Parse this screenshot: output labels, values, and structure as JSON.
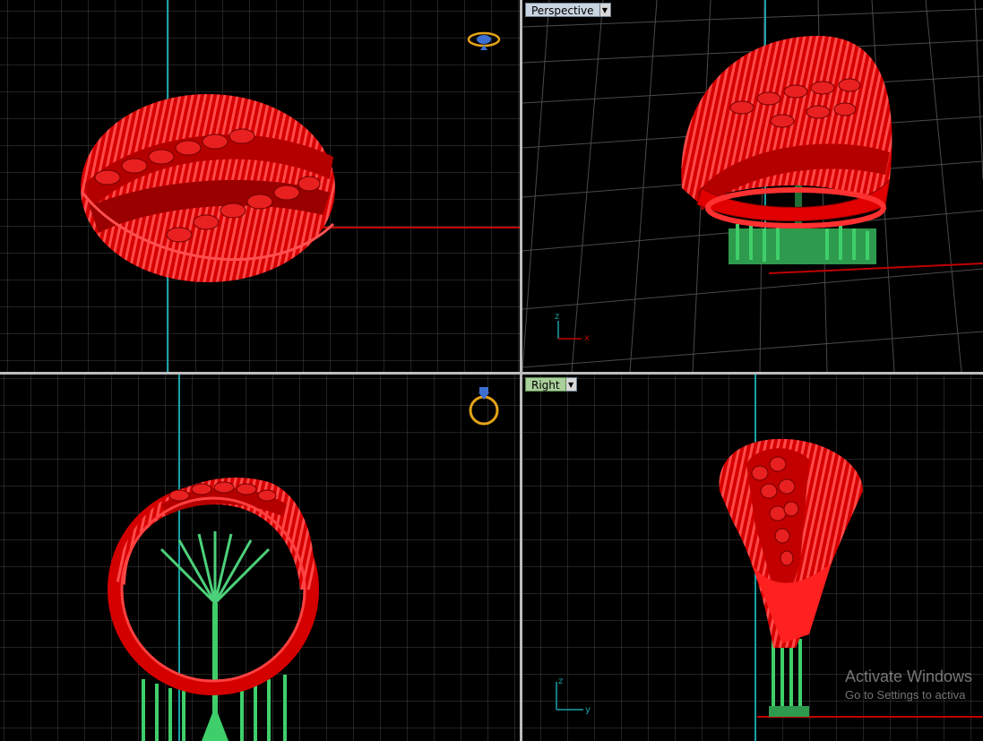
{
  "viewports": {
    "top": {
      "label": "",
      "icon": "ring-top-icon"
    },
    "perspective": {
      "label": "Perspective",
      "icon": ""
    },
    "front": {
      "label": "",
      "icon": "ring-front-icon"
    },
    "right": {
      "label": "Right",
      "icon": ""
    }
  },
  "axes": {
    "perspective": {
      "z": "z",
      "x": "x"
    },
    "right": {
      "z": "z",
      "y": "y"
    }
  },
  "watermark": {
    "title": "Activate Windows",
    "subtitle": "Go to Settings to activa"
  },
  "colors": {
    "model": "#e00000",
    "supports": "#33b35a",
    "grid": "#4a4a4a",
    "axis_x": "#c00000",
    "axis_y": "#1aa0a8",
    "active_label": "#a9cf9b"
  }
}
